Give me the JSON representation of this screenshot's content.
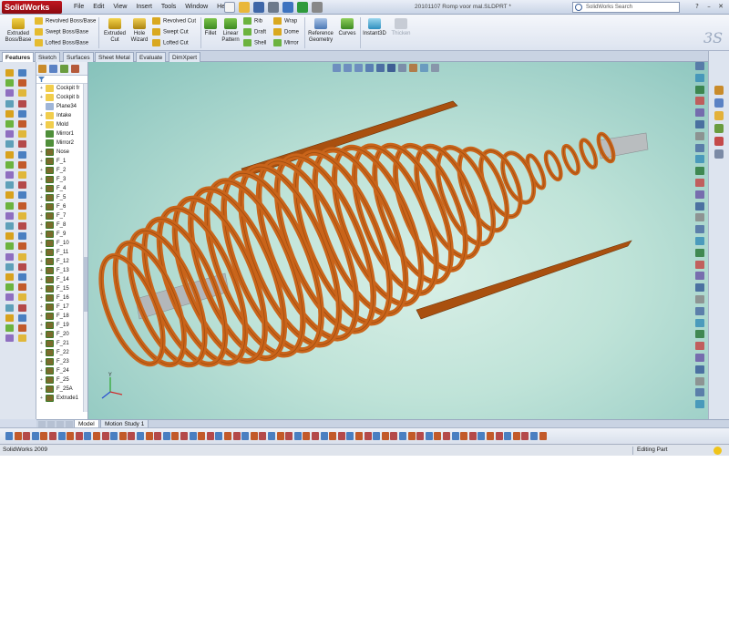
{
  "app": {
    "logo": "SolidWorks",
    "document_title": "20101107 Romp voor mal.SLDPRT *",
    "menu": [
      "File",
      "Edit",
      "View",
      "Insert",
      "Tools",
      "Window",
      "Help"
    ],
    "search_placeholder": "SolidWorks Search"
  },
  "command_manager": {
    "extruded_boss": "Extruded Boss/Base",
    "revolved_boss": "Revolved Boss/Base",
    "swept_boss": "Swept Boss/Base",
    "lofted_boss": "Lofted Boss/Base",
    "extruded_cut": "Extruded Cut",
    "hole_wizard": "Hole Wizard",
    "revolved_cut": "Revolved Cut",
    "swept_cut": "Swept Cut",
    "lofted_cut": "Lofted Cut",
    "fillet": "Fillet",
    "linear_pattern": "Linear Pattern",
    "rib": "Rib",
    "draft": "Draft",
    "shell": "Shell",
    "wrap": "Wrap",
    "dome": "Dome",
    "mirror": "Mirror",
    "reference_geometry": "Reference Geometry",
    "curves": "Curves",
    "instant3d": "Instant3D",
    "thicken": "Thicken"
  },
  "tabs": [
    "Features",
    "Sketch",
    "Surfaces",
    "Sheet Metal",
    "Evaluate",
    "DimXpert"
  ],
  "feature_tree": [
    {
      "label": "Cockpit fr",
      "expand": "+",
      "icon": "folder-icon"
    },
    {
      "label": "Cockpit b",
      "expand": "+",
      "icon": "folder-icon"
    },
    {
      "label": "Plane34",
      "expand": "",
      "icon": "plane-icon"
    },
    {
      "label": "Intake",
      "expand": "+",
      "icon": "folder-icon"
    },
    {
      "label": "Mold",
      "expand": "+",
      "icon": "folder-icon"
    },
    {
      "label": "Mirror1",
      "expand": "",
      "icon": "mirror-icon"
    },
    {
      "label": "Mirror2",
      "expand": "",
      "icon": "mirror-icon"
    },
    {
      "label": "Nose",
      "expand": "+",
      "icon": "feature-icon"
    },
    {
      "label": "F_1",
      "expand": "+",
      "icon": "feature-icon"
    },
    {
      "label": "F_2",
      "expand": "+",
      "icon": "feature-icon"
    },
    {
      "label": "F_3",
      "expand": "+",
      "icon": "feature-icon"
    },
    {
      "label": "F_4",
      "expand": "+",
      "icon": "feature-icon"
    },
    {
      "label": "F_5",
      "expand": "+",
      "icon": "feature-icon"
    },
    {
      "label": "F_6",
      "expand": "+",
      "icon": "feature-icon"
    },
    {
      "label": "F_7",
      "expand": "+",
      "icon": "feature-icon"
    },
    {
      "label": "F_8",
      "expand": "+",
      "icon": "feature-icon"
    },
    {
      "label": "F_9",
      "expand": "+",
      "icon": "feature-icon"
    },
    {
      "label": "F_10",
      "expand": "+",
      "icon": "feature-icon"
    },
    {
      "label": "F_11",
      "expand": "+",
      "icon": "feature-icon"
    },
    {
      "label": "F_12",
      "expand": "+",
      "icon": "feature-icon"
    },
    {
      "label": "F_13",
      "expand": "+",
      "icon": "feature-icon"
    },
    {
      "label": "F_14",
      "expand": "+",
      "icon": "feature-icon"
    },
    {
      "label": "F_15",
      "expand": "+",
      "icon": "feature-icon"
    },
    {
      "label": "F_16",
      "expand": "+",
      "icon": "feature-icon"
    },
    {
      "label": "F_17",
      "expand": "+",
      "icon": "feature-icon"
    },
    {
      "label": "F_18",
      "expand": "+",
      "icon": "feature-icon"
    },
    {
      "label": "F_19",
      "expand": "+",
      "icon": "feature-icon"
    },
    {
      "label": "F_20",
      "expand": "+",
      "icon": "feature-icon"
    },
    {
      "label": "F_21",
      "expand": "+",
      "icon": "feature-icon"
    },
    {
      "label": "F_22",
      "expand": "+",
      "icon": "feature-icon"
    },
    {
      "label": "F_23",
      "expand": "+",
      "icon": "feature-icon"
    },
    {
      "label": "F_24",
      "expand": "+",
      "icon": "feature-icon"
    },
    {
      "label": "F_25",
      "expand": "+",
      "icon": "feature-icon"
    },
    {
      "label": "F_25A",
      "expand": "+",
      "icon": "feature-icon"
    },
    {
      "label": "Extrude1",
      "expand": "+",
      "icon": "feature-icon"
    }
  ],
  "bottom_tabs": [
    "Model",
    "Motion Study 1"
  ],
  "status": {
    "left": "SolidWorks 2009",
    "right": "Editing Part"
  },
  "colors": {
    "part": "#c9641a",
    "part_dark": "#9a4a0e",
    "spar": "#b8b8b8",
    "background": "#bfe3d8"
  }
}
